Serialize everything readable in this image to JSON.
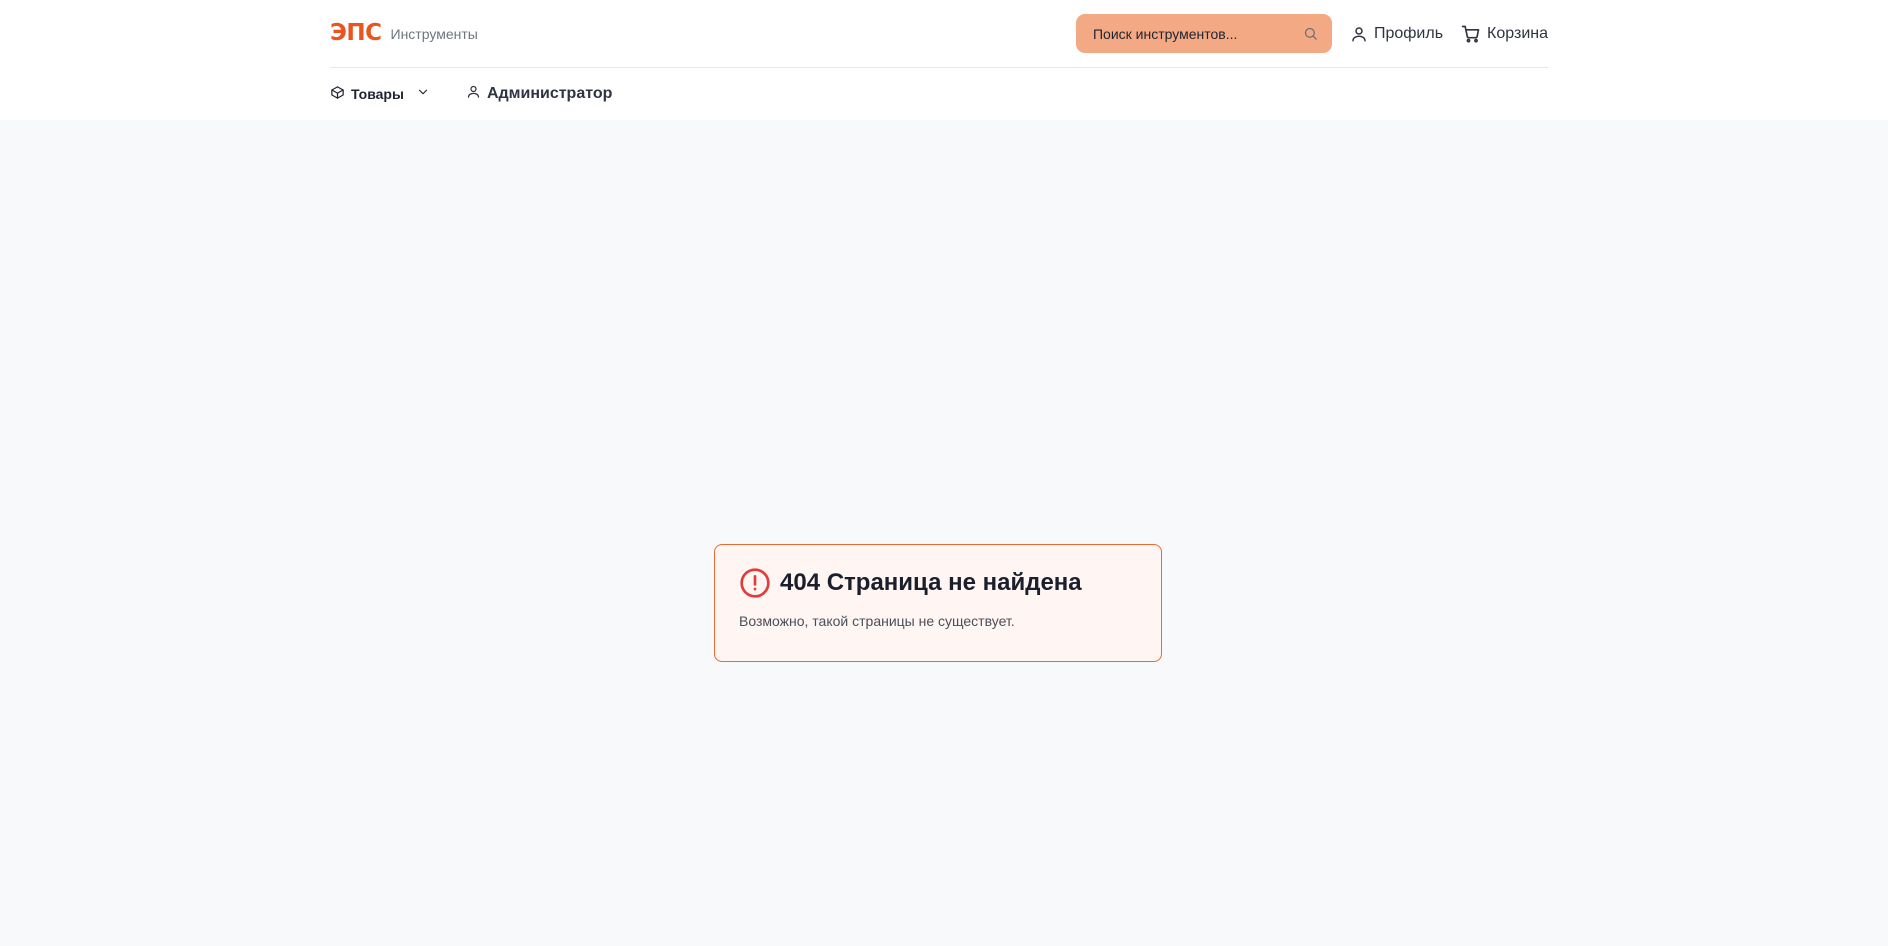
{
  "header": {
    "logo": "ЭПС",
    "brand_subtitle": "Инструменты",
    "search": {
      "placeholder": "Поиск инструментов..."
    },
    "profile_label": "Профиль",
    "cart_label": "Корзина"
  },
  "subnav": {
    "products_label": "Товары",
    "admin_label": "Администратор"
  },
  "error": {
    "title": "404 Страница не найдена",
    "description": "Возможно, такой страницы не существует."
  },
  "colors": {
    "accent": "#ea5420",
    "search_bg": "#f2a984",
    "error_border": "#ea6a33",
    "error_icon": "#e23b3b"
  },
  "icons": {
    "search": "search-icon",
    "profile": "user-icon",
    "cart": "cart-icon",
    "products": "box-icon",
    "products_dropdown": "chevron-down-icon",
    "admin": "user-icon",
    "error": "alert-circle-icon"
  }
}
